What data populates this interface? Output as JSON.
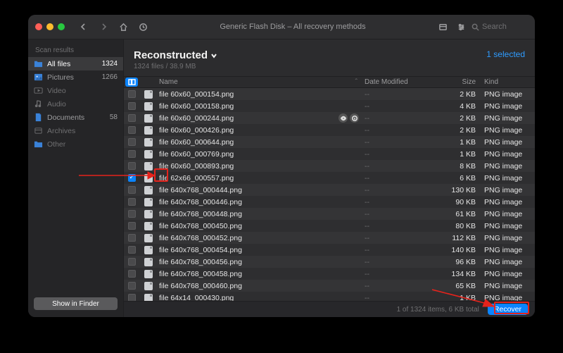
{
  "window_title": "Generic Flash Disk – All recovery methods",
  "search_placeholder": "Search",
  "sidebar": {
    "heading": "Scan results",
    "items": [
      {
        "icon": "folder",
        "label": "All files",
        "badge": "1324",
        "selected": true
      },
      {
        "icon": "picture",
        "label": "Pictures",
        "badge": "1266",
        "selected": false
      },
      {
        "icon": "video",
        "label": "Video",
        "badge": "",
        "selected": false,
        "dim": true
      },
      {
        "icon": "audio",
        "label": "Audio",
        "badge": "",
        "selected": false,
        "dim": true
      },
      {
        "icon": "document",
        "label": "Documents",
        "badge": "58",
        "selected": false
      },
      {
        "icon": "archive",
        "label": "Archives",
        "badge": "",
        "selected": false,
        "dim": true
      },
      {
        "icon": "folder",
        "label": "Other",
        "badge": "",
        "selected": false,
        "dim": true
      }
    ],
    "button_label": "Show in Finder"
  },
  "main": {
    "title": "Reconstructed",
    "subtitle": "1324 files / 38.9 MB",
    "selected_label": "1 selected"
  },
  "columns": {
    "name": "Name",
    "date": "Date Modified",
    "size": "Size",
    "kind": "Kind"
  },
  "rows": [
    {
      "name": "file 60x60_000154.png",
      "date": "--",
      "size": "2 KB",
      "kind": "PNG image",
      "checked": false,
      "hover": false
    },
    {
      "name": "file 60x60_000158.png",
      "date": "--",
      "size": "4 KB",
      "kind": "PNG image",
      "checked": false,
      "hover": false
    },
    {
      "name": "file 60x60_000244.png",
      "date": "--",
      "size": "2 KB",
      "kind": "PNG image",
      "checked": false,
      "hover": true
    },
    {
      "name": "file 60x60_000426.png",
      "date": "--",
      "size": "2 KB",
      "kind": "PNG image",
      "checked": false,
      "hover": false
    },
    {
      "name": "file 60x60_000644.png",
      "date": "--",
      "size": "1 KB",
      "kind": "PNG image",
      "checked": false,
      "hover": false
    },
    {
      "name": "file 60x60_000769.png",
      "date": "--",
      "size": "1 KB",
      "kind": "PNG image",
      "checked": false,
      "hover": false
    },
    {
      "name": "file 60x60_000893.png",
      "date": "--",
      "size": "8 KB",
      "kind": "PNG image",
      "checked": false,
      "hover": false
    },
    {
      "name": "file 62x66_000557.png",
      "date": "--",
      "size": "6 KB",
      "kind": "PNG image",
      "checked": true,
      "hover": false
    },
    {
      "name": "file 640x768_000444.png",
      "date": "--",
      "size": "130 KB",
      "kind": "PNG image",
      "checked": false,
      "hover": false
    },
    {
      "name": "file 640x768_000446.png",
      "date": "--",
      "size": "90 KB",
      "kind": "PNG image",
      "checked": false,
      "hover": false
    },
    {
      "name": "file 640x768_000448.png",
      "date": "--",
      "size": "61 KB",
      "kind": "PNG image",
      "checked": false,
      "hover": false
    },
    {
      "name": "file 640x768_000450.png",
      "date": "--",
      "size": "80 KB",
      "kind": "PNG image",
      "checked": false,
      "hover": false
    },
    {
      "name": "file 640x768_000452.png",
      "date": "--",
      "size": "112 KB",
      "kind": "PNG image",
      "checked": false,
      "hover": false
    },
    {
      "name": "file 640x768_000454.png",
      "date": "--",
      "size": "140 KB",
      "kind": "PNG image",
      "checked": false,
      "hover": false
    },
    {
      "name": "file 640x768_000456.png",
      "date": "--",
      "size": "96 KB",
      "kind": "PNG image",
      "checked": false,
      "hover": false
    },
    {
      "name": "file 640x768_000458.png",
      "date": "--",
      "size": "134 KB",
      "kind": "PNG image",
      "checked": false,
      "hover": false
    },
    {
      "name": "file 640x768_000460.png",
      "date": "--",
      "size": "65 KB",
      "kind": "PNG image",
      "checked": false,
      "hover": false
    },
    {
      "name": "file 64x14_000430.png",
      "date": "--",
      "size": "1 KB",
      "kind": "PNG image",
      "checked": false,
      "hover": false
    }
  ],
  "footer": {
    "status": "1 of 1324 items, 6 KB total",
    "recover_label": "Recover"
  }
}
